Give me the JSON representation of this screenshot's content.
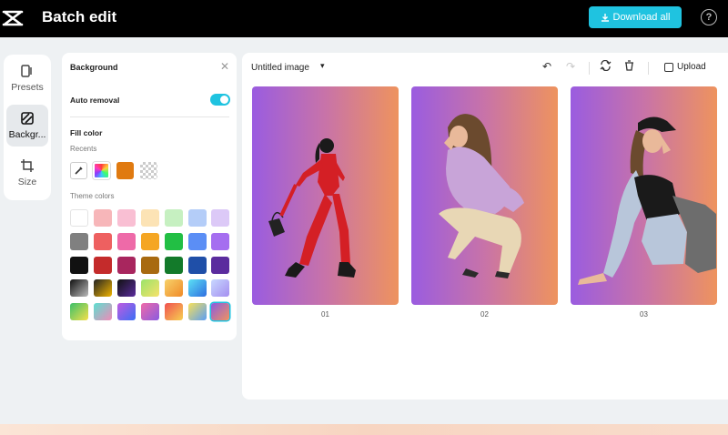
{
  "header": {
    "title": "Batch edit",
    "download_label": "Download all",
    "help_glyph": "?",
    "accent_color": "#1fc3e0"
  },
  "nav": {
    "items": [
      {
        "label": "Presets",
        "icon": "presets-icon"
      },
      {
        "label": "Backgr...",
        "icon": "background-icon",
        "active": true
      },
      {
        "label": "Size",
        "icon": "crop-icon"
      }
    ]
  },
  "panel": {
    "title": "Background",
    "close_glyph": "✕",
    "auto_removal_label": "Auto removal",
    "auto_removal_on": true,
    "fill_color_label": "Fill color",
    "recents_label": "Recents",
    "theme_colors_label": "Theme colors",
    "recents": [
      "color-picker",
      "#multicolor",
      "#e07a10",
      "transparent"
    ],
    "theme_rows": [
      [
        "#ffffff",
        "#f7b6b9",
        "#f9bfd3",
        "#fce3b5",
        "#c6f0c1",
        "#b4cdf8",
        "#dcc9f7"
      ],
      [
        "#808080",
        "#ee6060",
        "#ee6aa8",
        "#f5a623",
        "#22bf44",
        "#5b8ef5",
        "#a56ef0"
      ],
      [
        "#111111",
        "#c42b2b",
        "#a8265e",
        "#a86a10",
        "#137a2a",
        "#1f4fa8",
        "#5b2c9e"
      ],
      [
        "gradient-gray",
        "gradient-gold",
        "gradient-purple",
        "gradient-lime",
        "gradient-orange",
        "gradient-blue",
        "gradient-lilac"
      ],
      [
        "gradient-green-yellow",
        "gradient-aqua-pink",
        "gradient-violet-blue",
        "gradient-pink-purple",
        "gradient-red-yellow",
        "gradient-yellow-blue",
        "gradient-purple-orange"
      ]
    ]
  },
  "main": {
    "doc_title": "Untitled image",
    "upload_label": "Upload",
    "images": [
      {
        "label": "01"
      },
      {
        "label": "02"
      },
      {
        "label": "03"
      }
    ],
    "gradient_colors": [
      "#9a5ce0",
      "#ee935e"
    ]
  }
}
